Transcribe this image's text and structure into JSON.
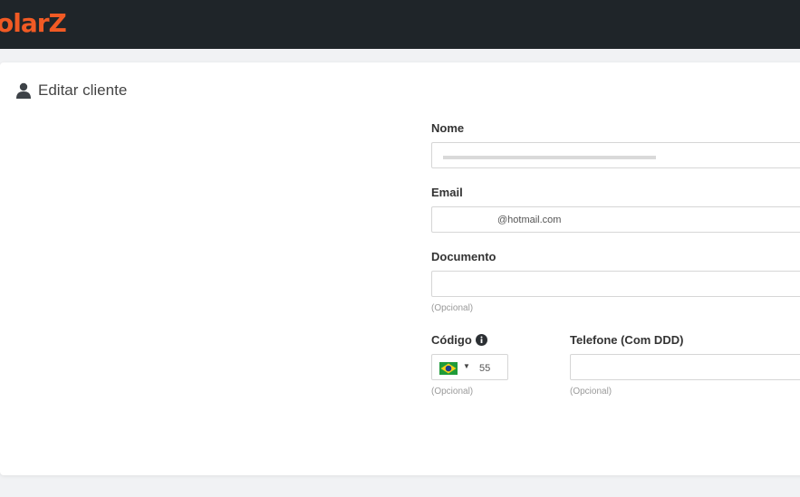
{
  "header": {
    "logo_text": "olarZ"
  },
  "form": {
    "title": "Editar cliente",
    "name": {
      "label": "Nome",
      "value": ""
    },
    "email": {
      "label": "Email",
      "value": "@hotmail.com"
    },
    "document": {
      "label": "Documento",
      "value": "",
      "hint": "(Opcional)"
    },
    "code": {
      "label": "Código",
      "country": "Brasil",
      "value": "55",
      "hint": "(Opcional)"
    },
    "phone": {
      "label": "Telefone (Com DDD)",
      "value": "",
      "hint": "(Opcional)"
    }
  },
  "icons": {
    "title": "user-icon",
    "code_info": "info-icon"
  },
  "colors": {
    "accent": "#f15a24",
    "topbar": "#1f2529"
  }
}
